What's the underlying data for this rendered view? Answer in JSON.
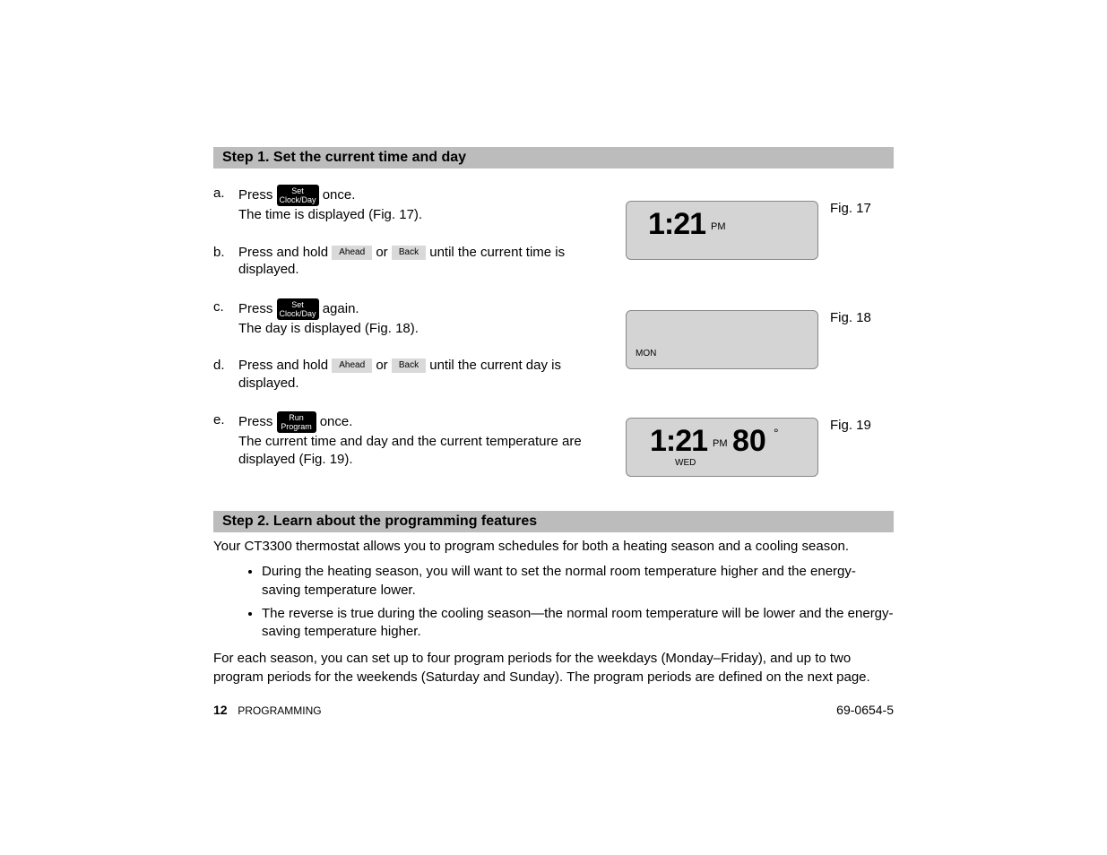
{
  "step1": {
    "header": "Step 1. Set the current time and day",
    "items": {
      "a": {
        "letter": "a.",
        "pre": "Press ",
        "btn_l1": "Set",
        "btn_l2": "Clock/Day",
        "post": " once.",
        "line2": "The time is displayed (Fig. 17)."
      },
      "b": {
        "letter": "b.",
        "pre": "Press and hold ",
        "btn1": "Ahead",
        "mid": " or ",
        "btn2": "Back",
        "post": " until the current time is displayed."
      },
      "c": {
        "letter": "c.",
        "pre": "Press ",
        "btn_l1": "Set",
        "btn_l2": "Clock/Day",
        "post": " again.",
        "line2": "The day is displayed (Fig. 18)."
      },
      "d": {
        "letter": "d.",
        "pre": "Press and hold ",
        "btn1": "Ahead",
        "mid": " or ",
        "btn2": "Back",
        "post": " until the current day is displayed."
      },
      "e": {
        "letter": "e.",
        "pre": "Press ",
        "btn_l1": "Run",
        "btn_l2": "Program",
        "post": " once.",
        "line2": "The current time and day and the current temperature are displayed (Fig. 19)."
      }
    },
    "fig17": {
      "label": "Fig. 17",
      "time": "1:21",
      "pm": "PM"
    },
    "fig18": {
      "label": "Fig. 18",
      "day": "MON"
    },
    "fig19": {
      "label": "Fig. 19",
      "time": "1:21",
      "pm": "PM",
      "temp": "80",
      "deg": "°",
      "day": "WED"
    }
  },
  "step2": {
    "header": "Step 2. Learn about the programming features",
    "p1": "Your CT3300 thermostat allows you to program schedules for both a heating season and a cooling season.",
    "b1": "During the heating season, you will want to set the normal room temperature higher and the energy-saving temperature lower.",
    "b2": "The reverse is true during the cooling season—the normal room temperature will be lower and the energy-saving temperature higher.",
    "p2": "For each season, you can set up to four program periods for the weekdays (Monday–Friday), and up to two program periods for the weekends (Saturday and Sunday).  The program periods are defined on the next page."
  },
  "footer": {
    "page": "12",
    "section": "PROGRAMMING",
    "docnum": "69-0654-5"
  }
}
